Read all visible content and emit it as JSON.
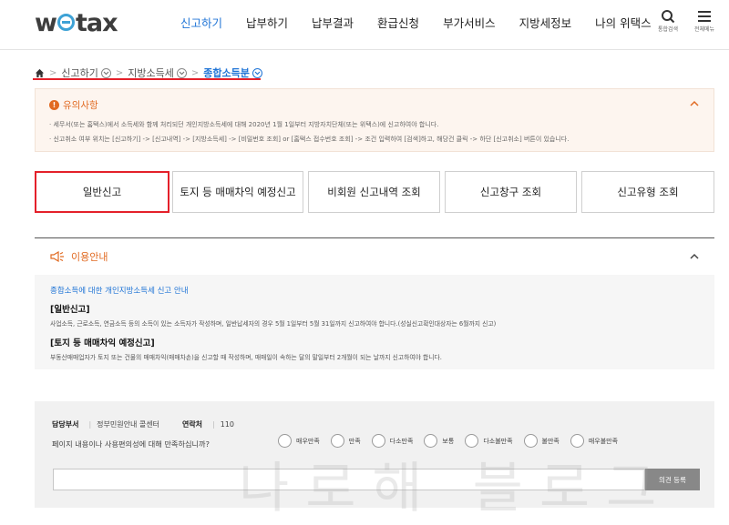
{
  "header": {
    "logo": {
      "pre": "w",
      "post": "tax"
    },
    "nav": [
      "신고하기",
      "납부하기",
      "납부결과",
      "환급신청",
      "부가서비스",
      "지방세정보",
      "나의 위택스"
    ],
    "active_nav": 0,
    "search_label": "통합검색",
    "menu_label": "전체메뉴"
  },
  "breadcrumb": {
    "items": [
      "신고하기",
      "지방소득세",
      "종합소득분"
    ]
  },
  "notice": {
    "title": "유의사항",
    "lines": [
      "· 세무서(또는 홈택스)에서 소득세와 함께 처리되던 개인지방소득세에 대해 2020년 1월 1일부터 지방자치단체(또는 위택스)에 신고하여야 합니다.",
      "· 신고취소 여부 위치는 [신고하기] -> [신고내역] -> [지방소득세] -> [비밀번호 조회] or [홈택스 접수번호 조회] -> 조건 입력하여 [검색]하고, 해당건 클릭 -> 하단 [신고취소] 버튼이 있습니다."
    ]
  },
  "options": [
    "일반신고",
    "토지 등 매매차익 예정신고",
    "비회원 신고내역 조회",
    "신고창구 조회",
    "신고유형 조회"
  ],
  "usage": {
    "heading": "이용안내",
    "title": "종합소득에 대한 개인지방소득세 신고 안내",
    "h1": "[일반신고]",
    "t1": "사업소득, 근로소득, 연금소득 등의 소득이 있는 소득자가 작성하며, 일반납세자의 경우 5월 1일부터 5월 31일까지 신고하여야 합니다.(성실신고확인대상자는 6월까지 신고)",
    "h2": "[토지 등 매매차익 예정신고]",
    "t2": "부동산매매업자가 토지 또는 건물의 매매차익(매매차손)을 신고할 때 작성하며, 매매일이 속하는 달의 말일부터 2개월이 되는 날까지 신고하여야 합니다."
  },
  "feedback": {
    "dept_label": "담당부서",
    "dept_value": "정부민원안내 콜센터",
    "contact_label": "연락처",
    "contact_value": "110",
    "question": "페이지 내용이나 사용편의성에 대해 만족하십니까?",
    "choices": [
      "매우만족",
      "만족",
      "다소만족",
      "보통",
      "다소불만족",
      "불만족",
      "매우불만족"
    ],
    "submit": "의견 등록"
  },
  "watermark": "나로해 블로그",
  "colors": {
    "accent": "#1f74d6",
    "highlight": "#e4202a",
    "notice": "#e16a22"
  }
}
